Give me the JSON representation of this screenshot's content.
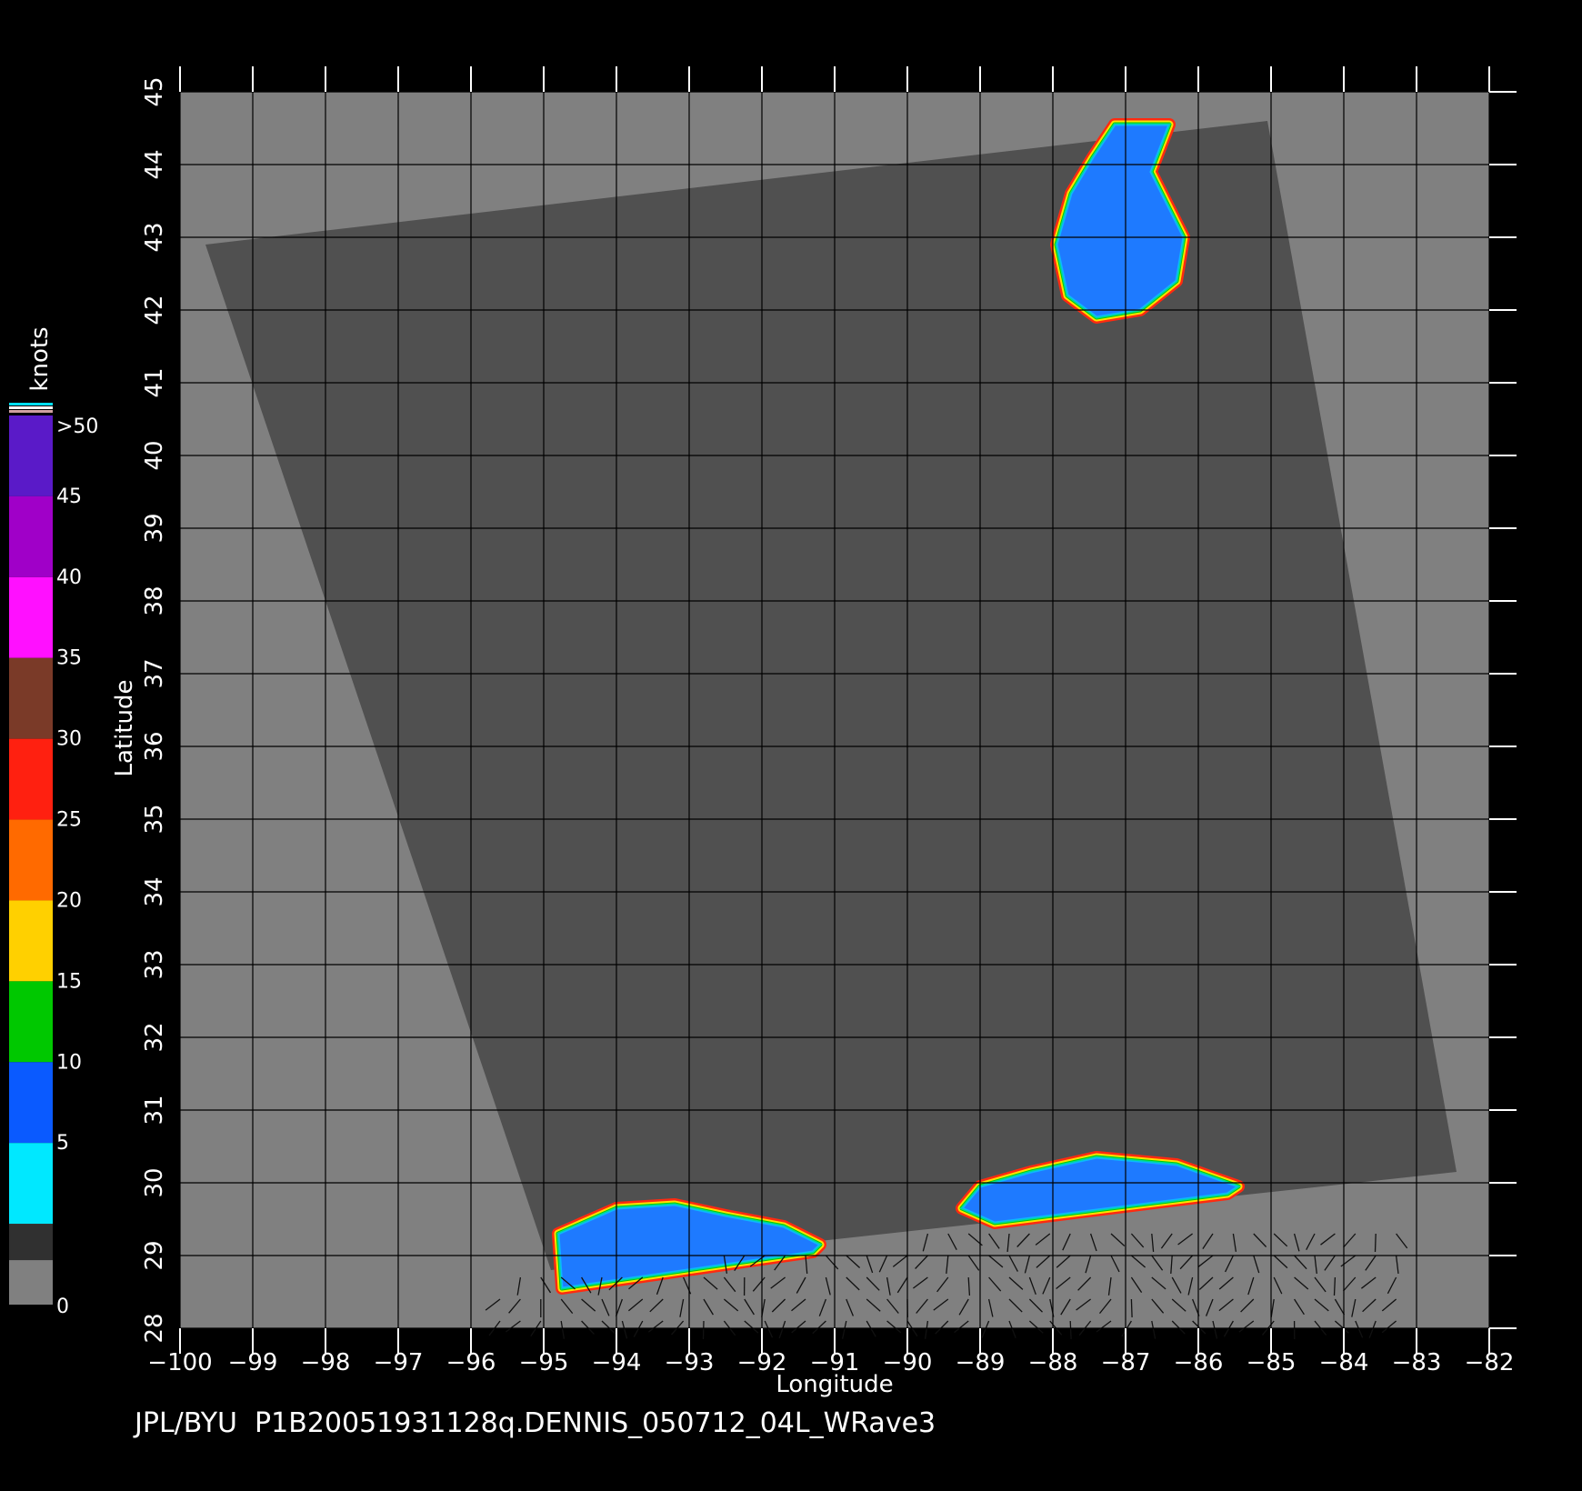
{
  "colors": {
    "background": "#000000",
    "land_outside_swath": "#808080",
    "swath": "#505050",
    "grid": "#000000",
    "ticks": "#ffffff"
  },
  "map": {
    "lon_range": [
      -100,
      -82
    ],
    "lat_range": [
      28,
      45
    ],
    "lon_ticks": [
      -100,
      -99,
      -98,
      -97,
      -96,
      -95,
      -94,
      -93,
      -92,
      -91,
      -90,
      -89,
      -88,
      -87,
      -86,
      -85,
      -84,
      -83,
      -82
    ],
    "lat_ticks": [
      28,
      29,
      30,
      31,
      32,
      33,
      34,
      35,
      36,
      37,
      38,
      39,
      40,
      41,
      42,
      43,
      44,
      45
    ],
    "x_label": "Longitude",
    "y_label": "Latitude",
    "swath_corners_lonlat": [
      [
        -99.65,
        42.9
      ],
      [
        -85.05,
        44.6
      ],
      [
        -82.45,
        30.15
      ],
      [
        -94.9,
        28.8
      ]
    ]
  },
  "colorbar": {
    "units": "knots",
    "labels": [
      ">50",
      "45",
      "40",
      "35",
      "30",
      "25",
      "20",
      "15",
      "10",
      "5",
      "0"
    ],
    "bands": [
      {
        "from": 50,
        "color": "#5a1ac8"
      },
      {
        "from": 45,
        "color": "#a000c8"
      },
      {
        "from": 40,
        "color": "#ff10ff"
      },
      {
        "from": 35,
        "color": "#7a3a28"
      },
      {
        "from": 30,
        "color": "#ff2010"
      },
      {
        "from": 25,
        "color": "#ff6a00"
      },
      {
        "from": 20,
        "color": "#ffd000"
      },
      {
        "from": 15,
        "color": "#00c800"
      },
      {
        "from": 10,
        "color": "#0a5aff"
      },
      {
        "from": 5,
        "color": "#00e8ff"
      },
      {
        "from": 0,
        "color": "#303030"
      }
    ]
  },
  "wind_regions": [
    {
      "name": "lake-michigan",
      "lonlat": [
        [
          -87.15,
          44.55
        ],
        [
          -86.4,
          44.55
        ],
        [
          -86.65,
          43.9
        ],
        [
          -86.2,
          43.0
        ],
        [
          -86.3,
          42.4
        ],
        [
          -86.8,
          42.0
        ],
        [
          -87.4,
          41.9
        ],
        [
          -87.8,
          42.2
        ],
        [
          -87.95,
          42.9
        ],
        [
          -87.75,
          43.6
        ],
        [
          -87.45,
          44.1
        ]
      ],
      "color": "#1e7aff"
    },
    {
      "name": "gulf-west",
      "lonlat": [
        [
          -94.8,
          29.3
        ],
        [
          -94.0,
          29.65
        ],
        [
          -93.2,
          29.7
        ],
        [
          -92.5,
          29.55
        ],
        [
          -91.7,
          29.4
        ],
        [
          -91.2,
          29.15
        ],
        [
          -91.3,
          29.05
        ],
        [
          -94.75,
          28.55
        ]
      ],
      "color": "#1e7aff"
    },
    {
      "name": "gulf-east",
      "lonlat": [
        [
          -89.0,
          29.95
        ],
        [
          -88.3,
          30.15
        ],
        [
          -87.4,
          30.35
        ],
        [
          -86.3,
          30.25
        ],
        [
          -85.45,
          29.95
        ],
        [
          -85.6,
          29.85
        ],
        [
          -88.8,
          29.45
        ],
        [
          -89.25,
          29.65
        ]
      ],
      "color": "#1e7aff"
    }
  ],
  "footer": {
    "caption": "JPL/BYU  P1B20051931128q.DENNIS_050712_04L_WRave3"
  }
}
